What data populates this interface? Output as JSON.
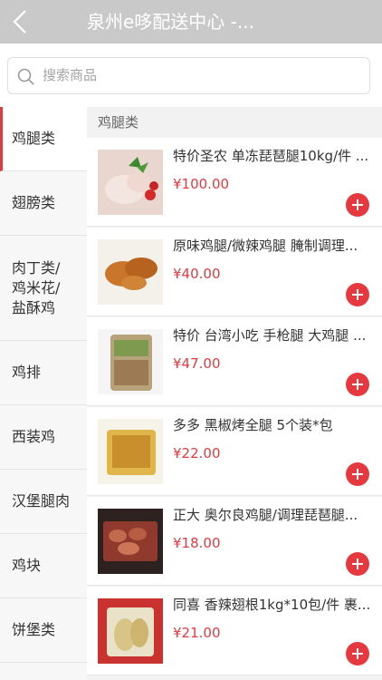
{
  "header": {
    "title": "泉州e哆配送中心 -...",
    "back_icon": "chevron-left-icon"
  },
  "search": {
    "placeholder": "搜索商品",
    "icon": "search-icon"
  },
  "sidebar": {
    "items": [
      {
        "label": "鸡腿类",
        "active": true
      },
      {
        "label": "翅膀类"
      },
      {
        "label": "肉丁类/\n鸡米花/\n盐酥鸡"
      },
      {
        "label": "鸡排"
      },
      {
        "label": "西装鸡"
      },
      {
        "label": "汉堡腿肉"
      },
      {
        "label": "鸡块"
      },
      {
        "label": "饼堡类"
      }
    ]
  },
  "main": {
    "section_title": "鸡腿类",
    "products": [
      {
        "name": "特价圣农 单冻琵琶腿10kg/件 ...",
        "price": "¥100.00"
      },
      {
        "name": "原味鸡腿/微辣鸡腿 腌制调理...",
        "price": "¥40.00"
      },
      {
        "name": "特价 台湾小吃 手枪腿 大鸡腿 ...",
        "price": "¥47.00"
      },
      {
        "name": "多多 黑椒烤全腿 5个装*包",
        "price": "¥22.00"
      },
      {
        "name": "正大 奥尔良鸡腿/调理琵琶腿...",
        "price": "¥18.00"
      },
      {
        "name": "同喜 香辣翅根1kg*10包/件 裹...",
        "price": "¥21.00"
      }
    ]
  },
  "colors": {
    "accent": "#e5393f",
    "header_bg": "#c9c9c9"
  }
}
